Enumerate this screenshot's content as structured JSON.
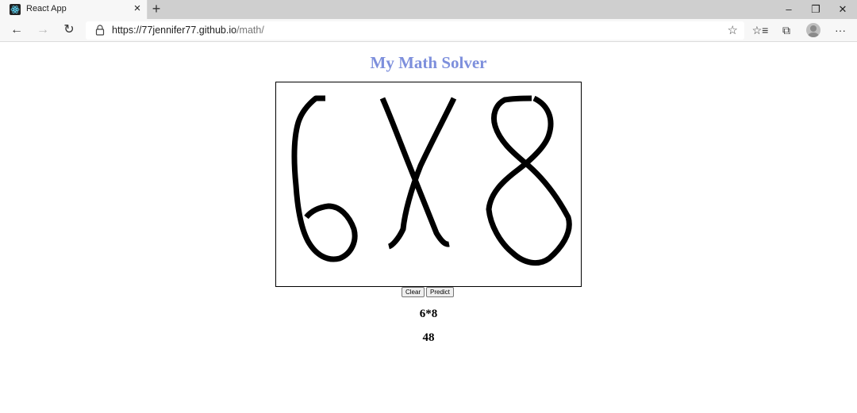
{
  "browser": {
    "tab_title": "React App",
    "tab_close": "×",
    "new_tab": "+",
    "url_host": "https://77jennifer77.github.io",
    "url_path": "/math/",
    "controls": {
      "minimize": "–",
      "restore": "❐",
      "close": "✕"
    },
    "nav": {
      "back": "←",
      "forward": "→",
      "reload": "↻"
    },
    "tools": {
      "favorite": "☆",
      "favorites_list": "☆≡",
      "collections": "⧉",
      "more": "···"
    }
  },
  "page": {
    "title": "My Math Solver",
    "buttons": {
      "clear": "Clear",
      "predict": "Predict"
    },
    "expression": "6*8",
    "result": "48"
  },
  "colors": {
    "title": "#7d8fdc",
    "stroke": "#000000"
  }
}
